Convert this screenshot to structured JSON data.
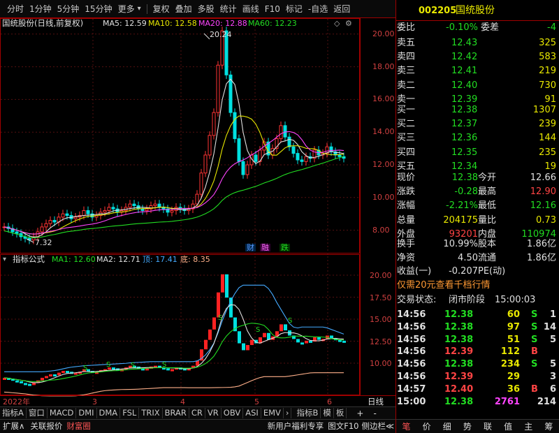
{
  "toolbar": {
    "tabs": [
      "分时",
      "1分钟",
      "5分钟",
      "15分钟",
      "更多"
    ],
    "actions": [
      "复权",
      "叠加",
      "多股",
      "统计",
      "画线",
      "F10",
      "标记",
      "-自选",
      "返回"
    ],
    "more_arrow": "▾"
  },
  "quote_header": {
    "code": "002205",
    "name": "国统股份"
  },
  "main_chart_info": {
    "title": "国统股份(日线,前复权)",
    "ma": [
      {
        "label": "MA5: 12.59",
        "color": "#e0e0e0"
      },
      {
        "label": "MA10: 12.58",
        "color": "#e8e800"
      },
      {
        "label": "MA20: 12.88",
        "color": "#ff44ff"
      },
      {
        "label": "MA60: 12.23",
        "color": "#22dd22"
      }
    ]
  },
  "indicator_info": {
    "title": "指标公式",
    "items": [
      {
        "label": "MA1: 12.60",
        "color": "#22dd22"
      },
      {
        "label": "MA2: 12.71",
        "color": "#e0e0e0"
      },
      {
        "label": "顶: 17.41",
        "color": "#44aaff"
      },
      {
        "label": "底: 8.35",
        "color": "#ffb08a"
      }
    ]
  },
  "price_axis": {
    "ticks": [
      "20.00",
      "18.00",
      "16.00",
      "14.00",
      "12.00",
      "10.00",
      "8.00"
    ]
  },
  "ind_axis": {
    "ticks": [
      "20.00",
      "17.50",
      "15.00",
      "12.50",
      "10.00"
    ]
  },
  "annotations": {
    "high": "20.24",
    "low": "7.32",
    "tags": [
      "财",
      "融",
      "跌"
    ],
    "s_mark": "S"
  },
  "date_axis": {
    "labels": [
      "2022年",
      "3",
      "4",
      "5",
      "6"
    ],
    "period": "日线",
    "plus": "+",
    "minus": "-"
  },
  "indicator_tabs": [
    "指标A",
    "窗口",
    "MACD",
    "DMI",
    "DMA",
    "FSL",
    "TRIX",
    "BRAR",
    "CR",
    "VR",
    "OBV",
    "ASI",
    "EMV"
  ],
  "indicator_tabs_right": [
    "指标B",
    "模",
    "板"
  ],
  "status_bar": {
    "left": [
      "扩展∧",
      "关联报价",
      "财富圈"
    ],
    "promo": "新用户福利专享",
    "figure": "图文F10",
    "side": "侧边栏≪"
  },
  "right_tabs": [
    "笔",
    "价",
    "细",
    "势",
    "联",
    "值",
    "主",
    "筹"
  ],
  "order_book": {
    "ratio": {
      "label1": "委比",
      "val1": "-0.10%",
      "label2": "委差",
      "val2": "-4"
    },
    "asks": [
      {
        "label": "卖五",
        "price": "12.43",
        "vol": "325"
      },
      {
        "label": "卖四",
        "price": "12.42",
        "vol": "583"
      },
      {
        "label": "卖三",
        "price": "12.41",
        "vol": "219"
      },
      {
        "label": "卖二",
        "price": "12.40",
        "vol": "730"
      },
      {
        "label": "卖一",
        "price": "12.39",
        "vol": "91"
      }
    ],
    "bids": [
      {
        "label": "买一",
        "price": "12.38",
        "vol": "1307"
      },
      {
        "label": "买二",
        "price": "12.37",
        "vol": "239"
      },
      {
        "label": "买三",
        "price": "12.36",
        "vol": "144"
      },
      {
        "label": "买四",
        "price": "12.35",
        "vol": "235"
      },
      {
        "label": "买五",
        "price": "12.34",
        "vol": "19"
      }
    ]
  },
  "stats1": [
    {
      "l1": "现价",
      "v1": "12.38",
      "c1": "#22dd22",
      "l2": "今开",
      "v2": "12.66",
      "c2": "#e0e0e0"
    },
    {
      "l1": "涨跌",
      "v1": "-0.28",
      "c1": "#22dd22",
      "l2": "最高",
      "v2": "12.90",
      "c2": "#ff4444"
    },
    {
      "l1": "涨幅",
      "v1": "-2.21%",
      "c1": "#22dd22",
      "l2": "最低",
      "v2": "12.16",
      "c2": "#22dd22"
    },
    {
      "l1": "总量",
      "v1": "204175",
      "c1": "#e8e800",
      "l2": "量比",
      "v2": "0.73",
      "c2": "#e8e800"
    },
    {
      "l1": "外盘",
      "v1": "93201",
      "c1": "#ff4444",
      "l2": "内盘",
      "v2": "110974",
      "c2": "#22dd22"
    }
  ],
  "stats2": [
    {
      "l1": "换手",
      "v1": "10.99%",
      "l2": "股本",
      "v2": "1.86亿"
    },
    {
      "l1": "净资",
      "v1": "4.50",
      "l2": "流通",
      "v2": "1.86亿"
    },
    {
      "l1": "收益(一)",
      "v1": "-0.207",
      "l2": "PE(动)",
      "v2": ""
    }
  ],
  "promo_line": "仅需20元查看千档行情",
  "trade_status": {
    "label": "交易状态:",
    "status": "闭市阶段",
    "time": "15:00:03"
  },
  "ticks": [
    {
      "time": "14:56",
      "price": "12.38",
      "vol": "60",
      "side": "S"
    },
    {
      "time": "14:56",
      "price": "12.38",
      "vol": "97",
      "side": "S"
    },
    {
      "time": "14:56",
      "price": "12.38",
      "vol": "51",
      "side": "S"
    },
    {
      "time": "14:56",
      "price": "12.39",
      "vol": "112",
      "side": "B"
    },
    {
      "time": "14:56",
      "price": "12.38",
      "vol": "234",
      "side": "S"
    },
    {
      "time": "14:56",
      "price": "12.39",
      "vol": "29",
      "side": ""
    },
    {
      "time": "14:57",
      "price": "12.40",
      "vol": "36",
      "side": "B"
    },
    {
      "time": "15:00",
      "price": "12.38",
      "vol": "2761",
      "side": ""
    }
  ],
  "tick_extras": {
    "r1": "1",
    "r2": "14",
    "r3": "5",
    "r5": "5",
    "r6": "3",
    "r7": "6",
    "r8": "214"
  },
  "colors": {
    "up": "#ff3333",
    "down": "#00e0e0",
    "ma5": "#e0e0e0",
    "ma10": "#e8e800",
    "ma20": "#ff44ff",
    "ma60": "#22dd22",
    "top": "#44aaff",
    "bottom": "#ffb08a",
    "border": "#a00000"
  }
}
